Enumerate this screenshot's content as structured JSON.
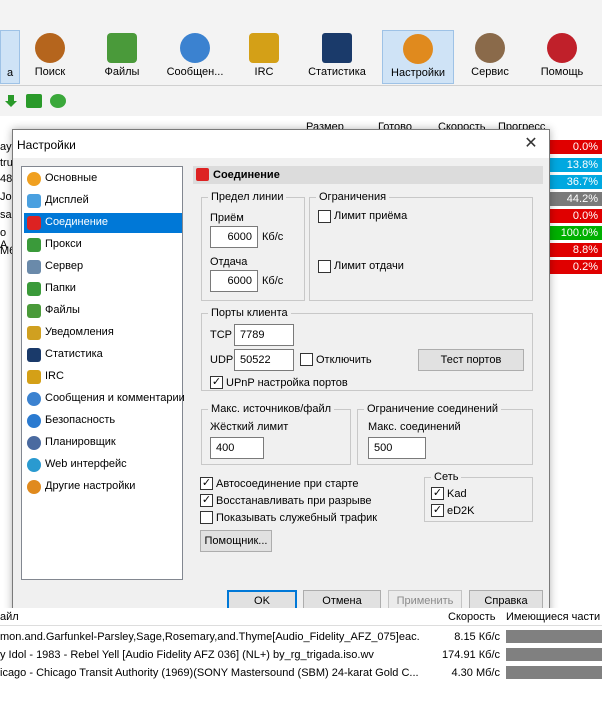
{
  "toolbar": {
    "items": [
      {
        "label": "а",
        "icon": "partial-icon"
      },
      {
        "label": "Поиск",
        "icon": "search-icon"
      },
      {
        "label": "Файлы",
        "icon": "files-icon"
      },
      {
        "label": "Сообщен...",
        "icon": "messages-icon"
      },
      {
        "label": "IRC",
        "icon": "irc-icon"
      },
      {
        "label": "Статистика",
        "icon": "statistics-icon"
      },
      {
        "label": "Настройки",
        "icon": "settings-icon"
      },
      {
        "label": "Сервис",
        "icon": "tools-icon"
      },
      {
        "label": "Помощь",
        "icon": "help-icon"
      }
    ]
  },
  "background": {
    "columns": {
      "size": "Размер",
      "done": "Готово",
      "speed": "Скорость",
      "progress": "Прогресс"
    },
    "left_fragments": [
      "ay",
      "tru",
      "48",
      "Joo",
      "sa",
      "o A",
      "M6"
    ],
    "progress": [
      {
        "value": "0.0%",
        "color": "#e00000"
      },
      {
        "value": "13.8%",
        "color": "#00a8e0"
      },
      {
        "value": "36.7%",
        "color": "#00a8e0"
      },
      {
        "value": "44.2%",
        "color": "#7a7a7a"
      },
      {
        "value": "0.0%",
        "color": "#e00000"
      },
      {
        "value": "100.0%",
        "color": "#00b000"
      },
      {
        "value": "8.8%",
        "color": "#e00000"
      },
      {
        "value": "0.2%",
        "color": "#e00000"
      }
    ]
  },
  "dialog": {
    "title": "Настройки",
    "close": "✕",
    "nav": [
      {
        "label": "Основные",
        "icon": "general-icon"
      },
      {
        "label": "Дисплей",
        "icon": "display-icon"
      },
      {
        "label": "Соединение",
        "icon": "connection-icon"
      },
      {
        "label": "Прокси",
        "icon": "proxy-icon"
      },
      {
        "label": "Сервер",
        "icon": "server-icon"
      },
      {
        "label": "Папки",
        "icon": "folders-icon"
      },
      {
        "label": "Файлы",
        "icon": "files-icon"
      },
      {
        "label": "Уведомления",
        "icon": "notifications-icon"
      },
      {
        "label": "Статистика",
        "icon": "statistics-icon"
      },
      {
        "label": "IRC",
        "icon": "irc-icon"
      },
      {
        "label": "Сообщения и комментарии",
        "icon": "messages-icon"
      },
      {
        "label": "Безопасность",
        "icon": "security-icon"
      },
      {
        "label": "Планировщик",
        "icon": "scheduler-icon"
      },
      {
        "label": "Web интерфейс",
        "icon": "web-icon"
      },
      {
        "label": "Другие настройки",
        "icon": "other-settings-icon"
      }
    ],
    "selected_nav": "Соединение",
    "panel": {
      "title": "Соединение",
      "line_limit": {
        "title": "Предел линии",
        "download_label": "Приём",
        "download_value": "6000",
        "download_unit": "Кб/с",
        "upload_label": "Отдача",
        "upload_value": "6000",
        "upload_unit": "Кб/с"
      },
      "limits": {
        "title": "Ограничения",
        "download_limit": "Лимит приёма",
        "upload_limit": "Лимит отдачи"
      },
      "ports": {
        "title": "Порты клиента",
        "tcp_label": "TCP",
        "tcp_value": "7789",
        "udp_label": "UDP",
        "udp_value": "50522",
        "disable_label": "Отключить",
        "test_button": "Тест портов",
        "upnp_label": "UPnP настройка портов",
        "upnp_mark": "✓"
      },
      "max_sources": {
        "title": "Макс. источников/файл",
        "hard_limit_label": "Жёсткий лимит",
        "hard_limit_value": "400"
      },
      "conn_limit": {
        "title": "Ограничение соединений",
        "max_label": "Макс. соединений",
        "max_value": "500"
      },
      "options": [
        {
          "label": "Автосоединение при старте",
          "mark": "✓"
        },
        {
          "label": "Восстанавливать при разрыве",
          "mark": "✓"
        },
        {
          "label": "Показывать служебный трафик",
          "mark": ""
        }
      ],
      "network": {
        "title": "Сеть",
        "items": [
          {
            "label": "Kad",
            "mark": "✓"
          },
          {
            "label": "eD2K",
            "mark": "✓"
          }
        ]
      },
      "wizard_button": "Помощник..."
    },
    "buttons": {
      "ok": "OK",
      "cancel": "Отмена",
      "apply": "Применить",
      "help": "Справка"
    }
  },
  "bottom_list": {
    "head_left": "айл",
    "head_speed": "Скорость",
    "head_parts": "Имеющиеся части",
    "rows": [
      {
        "name": "mon.and.Garfunkel-Parsley,Sage,Rosemary,and.Thyme[Audio_Fidelity_AFZ_075]eac...",
        "speed": "8.15 Кб/с"
      },
      {
        "name": "y Idol - 1983 - Rebel Yell [Audio Fidelity AFZ 036] (NL+) by_rg_trigada.iso.wv",
        "speed": "174.91 Кб/с"
      },
      {
        "name": "icago - Chicago Transit Authority (1969)(SONY  Mastersound (SBM) 24-karat Gold C...",
        "speed": "4.30 Мб/с"
      }
    ]
  }
}
